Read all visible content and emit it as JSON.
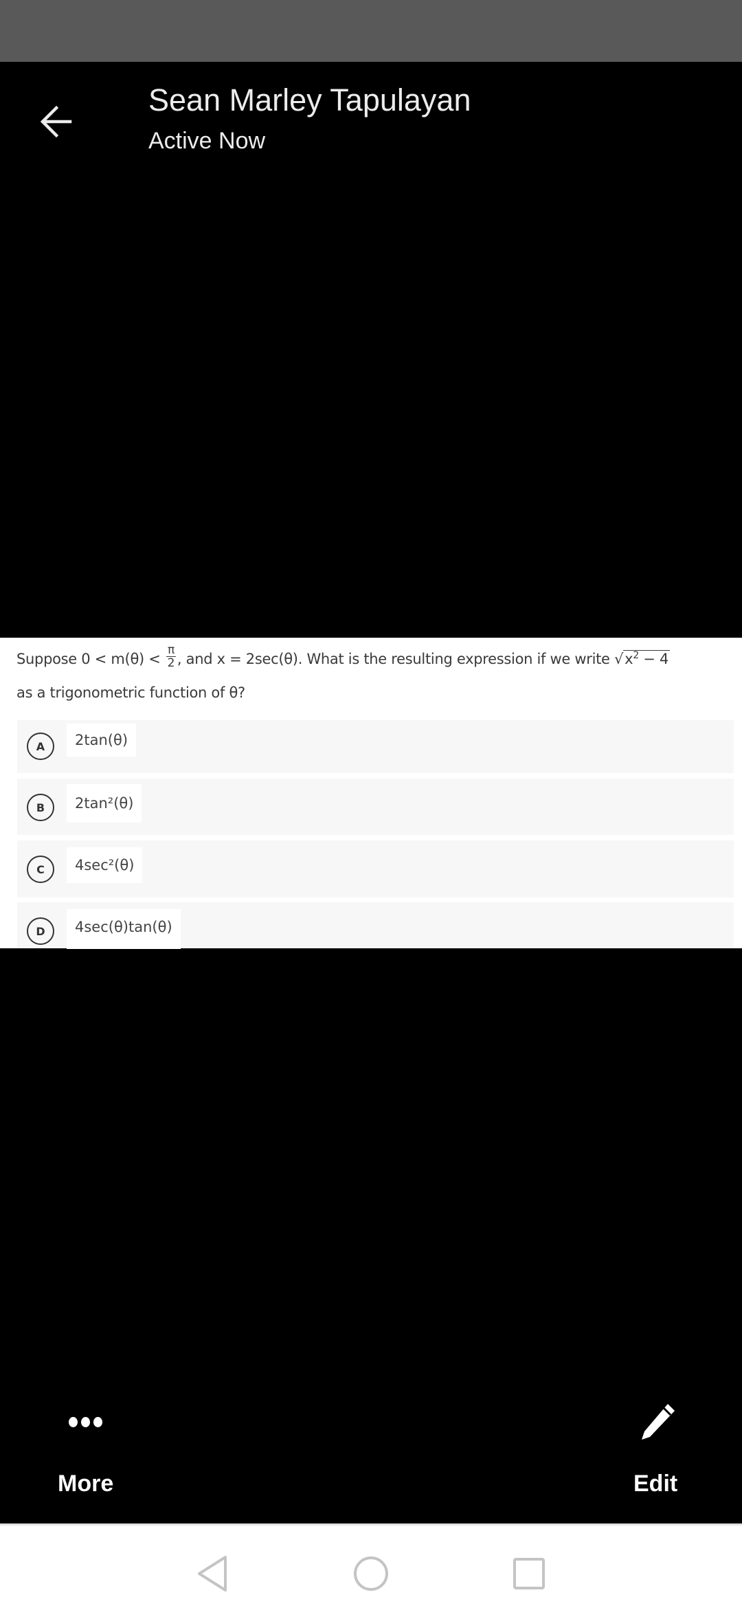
{
  "header": {
    "contact_name": "Sean Marley Tapulayan",
    "status": "Active Now",
    "back_icon": "arrow-left-icon"
  },
  "question": {
    "line1_prefix": "Suppose 0 < m(θ) <",
    "fraction_num": "π",
    "fraction_den": "2",
    "line1_middle": ", and x = 2sec(θ). What is the resulting expression if we write",
    "sqrt_radicand_base": "x",
    "sqrt_radicand_exp": "2",
    "sqrt_radicand_rest": " − 4",
    "line2": "as a trigonometric function of θ?"
  },
  "options": [
    {
      "letter": "A",
      "text": "2tan(θ)"
    },
    {
      "letter": "B",
      "text": "2tan²(θ)"
    },
    {
      "letter": "C",
      "text": "4sec²(θ)"
    },
    {
      "letter": "D",
      "text": "4sec(θ)tan(θ)"
    }
  ],
  "actions": {
    "more_label": "More",
    "more_icon": "more-dots-icon",
    "edit_label": "Edit",
    "edit_icon": "pencil-icon"
  },
  "navbar": {
    "back": "nav-back-icon",
    "home": "nav-home-icon",
    "recents": "nav-recents-icon"
  },
  "colors": {
    "status_bar": "#595959",
    "background": "#000000",
    "panel": "#ffffff",
    "option_bg": "#f7f7f7",
    "nav_icon": "#c4c4c4"
  }
}
